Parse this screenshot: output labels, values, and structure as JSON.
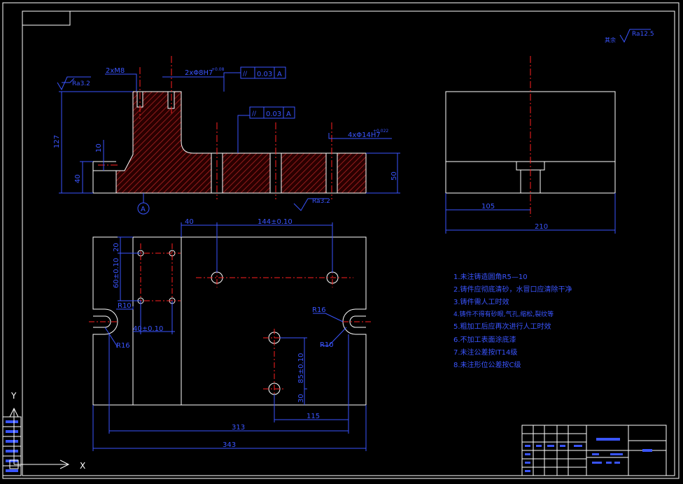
{
  "colors": {
    "background": "#000000",
    "outline": "#ffffff",
    "dimension": "#3a55ff",
    "centerline": "#ff2020",
    "hatch": "#b02020",
    "notes": "#3a55ff"
  },
  "roughness": {
    "general": "Ra12.5",
    "general_prefix": "其余",
    "top_face": "Ra3.2",
    "bottom_face": "Ra3.2"
  },
  "section_view": {
    "dims": {
      "thread_small": "2xM8",
      "thread_pin": "2xΦ8H7",
      "pin_tol": "+0.08",
      "tol_frame1_sym": "//",
      "tol_frame1_val": "0.03",
      "tol_frame1_ref": "A",
      "tol_frame2_sym": "//",
      "tol_frame2_val": "0.03",
      "tol_frame2_ref": "A",
      "holes": "4xΦ14H7",
      "holes_tol": "+0.022",
      "total_height": "127",
      "step_10": "10",
      "step_40": "40",
      "right_50": "50"
    },
    "datum": "A"
  },
  "side_view": {
    "dim_105": "105",
    "dim_210": "210"
  },
  "plan_view": {
    "dim_40": "40",
    "dim_144": "144±0.10",
    "dim_60_10": "60±0.10",
    "dim_20": "20",
    "dim_40_10": "40±0.10",
    "r10_left": "R10",
    "r16_left": "R16",
    "r16_right": "R16",
    "r10_right": "R10",
    "dim_85": "85±0.10",
    "dim_30": "30",
    "dim_115": "115",
    "dim_313": "313",
    "dim_343": "343"
  },
  "notes": [
    "1.未注铸造圆角R5—10",
    "2.铸件应彻底清砂，水冒口应清除干净",
    "3.铸件需人工时效",
    "4.铸件不得有砂眼,气孔,缩松,裂纹等",
    "5.粗加工后应再次进行人工时效",
    "6.不加工表面涂底漆",
    "7.未注公差按IT14级",
    "8.未注形位公差按C级"
  ],
  "axes": {
    "x": "X",
    "y": "Y"
  }
}
